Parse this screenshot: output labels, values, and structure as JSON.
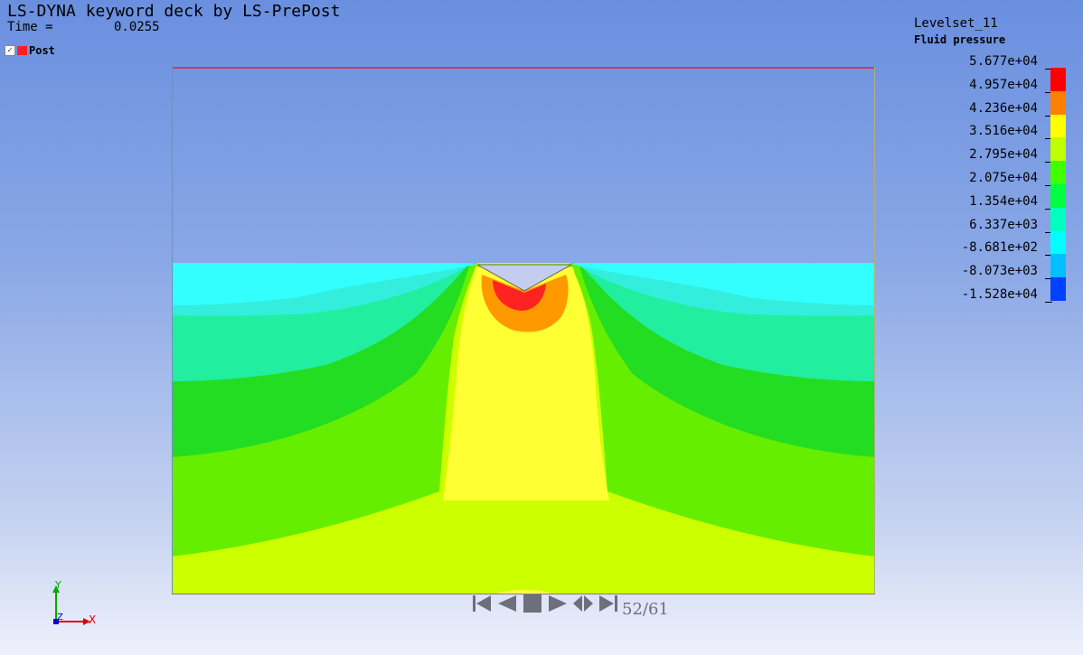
{
  "header": {
    "title": "LS-DYNA keyword deck by LS-PrePost",
    "time_label": "Time =",
    "time_value": "0.0255"
  },
  "parts": [
    {
      "label": "Post",
      "color": "#ff2020",
      "checked": true
    }
  ],
  "legend": {
    "title": "Levelset_11",
    "subtitle": "Fluid pressure",
    "labels": [
      "5.677e+04",
      "4.957e+04",
      "4.236e+04",
      "3.516e+04",
      "2.795e+04",
      "2.075e+04",
      "1.354e+04",
      "6.337e+03",
      "-8.681e+02",
      "-8.073e+03",
      "-1.528e+04"
    ],
    "colors": [
      "#ff0000",
      "#ff7f00",
      "#ffff00",
      "#bfff00",
      "#40ff00",
      "#00ff40",
      "#00ffbf",
      "#00ffff",
      "#00bfff",
      "#0040ff",
      "#0000ff"
    ]
  },
  "axis_triad": {
    "y_label": "Y",
    "z_label": "Z",
    "x_label": "X"
  },
  "animation": {
    "icons": [
      "first-frame-icon",
      "step-back-icon",
      "stop-icon",
      "play-icon",
      "play-pause-toggle-icon",
      "last-frame-icon"
    ],
    "frame_current": 52,
    "frame_total": 61,
    "frame_text": "52/61"
  }
}
